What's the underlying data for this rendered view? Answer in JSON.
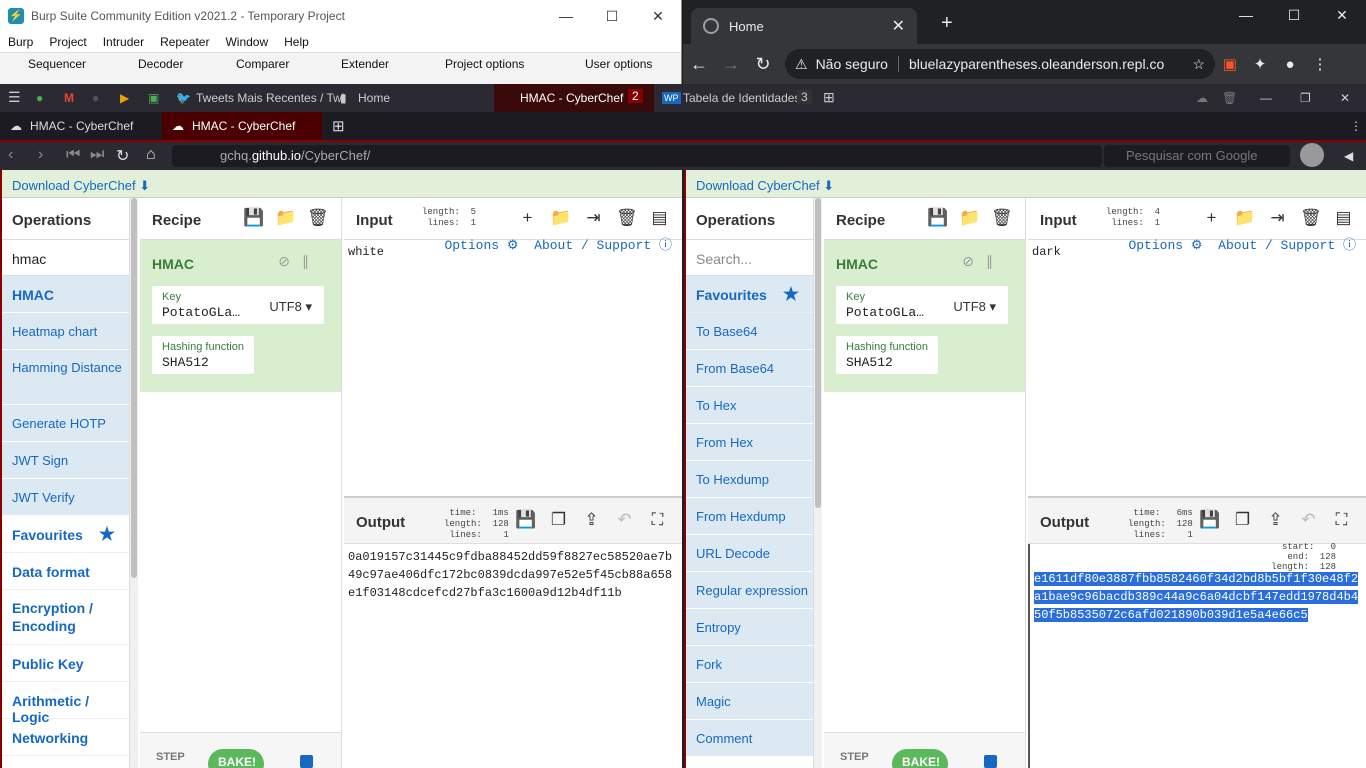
{
  "burp": {
    "title": "Burp Suite Community Edition v2021.2 - Temporary Project",
    "menu": [
      "Burp",
      "Project",
      "Intruder",
      "Repeater",
      "Window",
      "Help"
    ],
    "tabs": [
      "Sequencer",
      "Decoder",
      "Comparer",
      "Extender",
      "Project options",
      "User options"
    ]
  },
  "chrome": {
    "tab_title": "Home",
    "not_secure": "Não seguro",
    "url": "bluelazyparentheses.oleanderson.repl.co"
  },
  "firefox": {
    "bookmarks": [
      "Tweets Mais Recentes / Twi",
      "Home"
    ],
    "top_tabs": [
      {
        "label": "HMAC - CyberChef",
        "count": "2"
      },
      {
        "label": "Tabela de Identidades",
        "count": "3"
      }
    ],
    "tabs": [
      "HMAC - CyberChef",
      "HMAC - CyberChef"
    ],
    "url_prefix": "gchq.",
    "url_domain": "github.io",
    "url_path": "/CyberChef/",
    "search_placeholder": "Pesquisar com Google"
  },
  "left": {
    "download": "Download CyberChef",
    "operations_title": "Operations",
    "search_value": "hmac",
    "ops": [
      "HMAC",
      "Heatmap chart",
      "Hamming Distance",
      "Generate HOTP",
      "JWT Sign",
      "JWT Verify"
    ],
    "cats": [
      "Favourites",
      "Data format",
      "Encryption / Encoding",
      "Public Key",
      "Arithmetic / Logic",
      "Networking"
    ],
    "recipe_title": "Recipe",
    "op_name": "HMAC",
    "key_label": "Key",
    "key_value": "PotatoGLa…",
    "key_enc": "UTF8",
    "hash_label": "Hashing function",
    "hash_value": "SHA512",
    "input_title": "Input",
    "input_meta": "length:  5\nlines:  1",
    "input_text": "white",
    "options_link": "Options",
    "about_link": "About / Support",
    "output_title": "Output",
    "output_meta": "time:   1ms\nlength:  128\nlines:    1",
    "output_text": "0a019157c31445c9fdba88452dd59f8827ec58520ae7b49c97ae406dfc172bc0839dcda997e52e5f45cb88a658e1f03148cdcefcd27bfa3c1600a9d12b4df11b",
    "step": "STEP",
    "bake": "BAKE!"
  },
  "right": {
    "download": "Download CyberChef",
    "operations_title": "Operations",
    "search_placeholder": "Search...",
    "fav": "Favourites",
    "ops": [
      "To Base64",
      "From Base64",
      "To Hex",
      "From Hex",
      "To Hexdump",
      "From Hexdump",
      "URL Decode",
      "Regular expression",
      "Entropy",
      "Fork",
      "Magic",
      "Comment"
    ],
    "recipe_title": "Recipe",
    "op_name": "HMAC",
    "key_label": "Key",
    "key_value": "PotatoGLa…",
    "key_enc": "UTF8",
    "hash_label": "Hashing function",
    "hash_value": "SHA512",
    "input_title": "Input",
    "input_meta": "length:  4\nlines:  1",
    "input_text": "dark",
    "options_link": "Options",
    "about_link": "About / Support",
    "output_title": "Output",
    "output_meta": "time:   6ms\nlength:  128\nlines:    1",
    "sel_meta": "start:   0\nend:  128\nlength:  128",
    "output_text": "e1611df80e3887fbb8582460f34d2bd8b5bf1f30e48f2a1bae9c96bacdb389c44a9c6a04dcbf147edd1978d4b450f5b8535072c6afd021890b039d1e5a4e66c5",
    "step": "STEP",
    "bake": "BAKE!"
  }
}
